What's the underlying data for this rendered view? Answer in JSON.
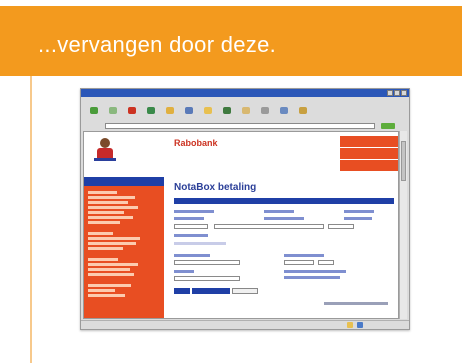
{
  "slide": {
    "title": "...vervangen door deze.",
    "header_color": "#f39a1e",
    "accent_color": "#f7c98c"
  },
  "screenshot": {
    "site_title": "Rabobank",
    "page_heading": "NotaBox betaling",
    "brand_orange": "#e84e22",
    "brand_blue": "#1f3fa6",
    "toolbar_icons": [
      "back-icon",
      "forward-icon",
      "stop-icon",
      "refresh-icon",
      "home-icon",
      "search-icon",
      "favorites-icon",
      "history-icon",
      "mail-icon",
      "print-icon",
      "edit-icon",
      "discuss-icon"
    ],
    "status_icons": [
      "lock-icon",
      "globe-icon"
    ]
  }
}
